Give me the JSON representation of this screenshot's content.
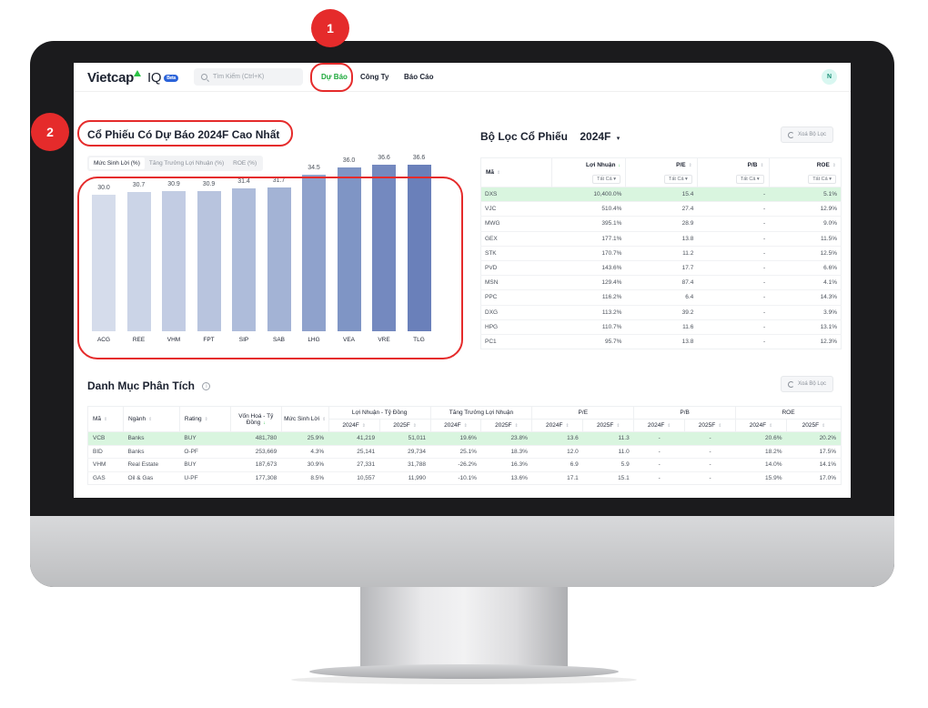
{
  "nav": {
    "logo": "Vietcap",
    "logo_suffix": "IQ",
    "logo_badge": "Beta",
    "search_placeholder": "Tìm Kiếm (Ctrl+K)",
    "menu": [
      "Dự Báo",
      "Công Ty",
      "Báo Cáo"
    ],
    "active_menu": "Dự Báo",
    "avatar": "N"
  },
  "callouts": [
    "1",
    "2"
  ],
  "forecast": {
    "title": "Cổ Phiếu Có Dự Báo 2024F Cao Nhất",
    "tabs": [
      "Mức Sinh Lời (%)",
      "Tăng Trưởng Lợi Nhuận (%)",
      "ROE (%)"
    ],
    "active_tab": "Mức Sinh Lời (%)"
  },
  "chart_data": {
    "type": "bar",
    "categories": [
      "ACG",
      "REE",
      "VHM",
      "FPT",
      "SIP",
      "SAB",
      "LHG",
      "VEA",
      "VRE",
      "TLG"
    ],
    "values": [
      30.0,
      30.7,
      30.9,
      30.9,
      31.4,
      31.7,
      34.5,
      36.0,
      36.6,
      36.6
    ],
    "value_labels": [
      "30.0",
      "30.7",
      "30.9",
      "30.9",
      "31.4",
      "31.7",
      "34.5",
      "36.0",
      "36.6",
      "36.6"
    ],
    "colors": [
      "#d5dceb",
      "#cbd4e7",
      "#c2cce3",
      "#b8c4de",
      "#aebcda",
      "#a3b3d5",
      "#8fa2cc",
      "#7f95c5",
      "#7489bf",
      "#6a80ba"
    ],
    "ylim": [
      0,
      40
    ],
    "grid": false
  },
  "filter": {
    "title": "Bộ Lọc Cổ Phiếu",
    "year": "2024F",
    "clear_label": "Xoá Bộ Lọc",
    "headers": [
      "Mã",
      "Lợi Nhuận",
      "P/E",
      "P/B",
      "ROE"
    ],
    "filter_label": "Tất Cả",
    "rows": [
      [
        "DXS",
        "10,400.0%",
        "15.4",
        "-",
        "5.1%"
      ],
      [
        "VJC",
        "510.4%",
        "27.4",
        "-",
        "12.9%"
      ],
      [
        "MWG",
        "395.1%",
        "28.9",
        "-",
        "9.0%"
      ],
      [
        "GEX",
        "177.1%",
        "13.8",
        "-",
        "11.5%"
      ],
      [
        "STK",
        "170.7%",
        "11.2",
        "-",
        "12.5%"
      ],
      [
        "PVD",
        "143.6%",
        "17.7",
        "-",
        "6.6%"
      ],
      [
        "MSN",
        "129.4%",
        "87.4",
        "-",
        "4.1%"
      ],
      [
        "PPC",
        "116.2%",
        "6.4",
        "-",
        "14.3%"
      ],
      [
        "DXG",
        "113.2%",
        "39.2",
        "-",
        "3.9%"
      ],
      [
        "HPG",
        "110.7%",
        "11.6",
        "-",
        "13.1%"
      ],
      [
        "PC1",
        "95.7%",
        "13.8",
        "-",
        "12.3%"
      ]
    ]
  },
  "portfolio": {
    "title": "Danh Mục Phân Tích",
    "clear_label": "Xoá Bộ Lọc",
    "headers": [
      "Mã",
      "Ngành",
      "Rating",
      "Vốn Hoá - Tỷ Đồng",
      "Mức Sinh Lời",
      "Lợi Nhuận - Tỷ Đồng",
      "Tăng Trưởng Lợi Nhuận",
      "P/E",
      "P/B",
      "ROE"
    ],
    "years": [
      "2024F",
      "2025F"
    ],
    "rows": [
      [
        "VCB",
        "Banks",
        "BUY",
        "481,780",
        "25.9%",
        "41,219",
        "51,011",
        "19.6%",
        "23.8%",
        "13.6",
        "11.3",
        "-",
        "-",
        "20.6%",
        "20.2%"
      ],
      [
        "BID",
        "Banks",
        "O-PF",
        "253,669",
        "4.3%",
        "25,141",
        "29,734",
        "25.1%",
        "18.3%",
        "12.0",
        "11.0",
        "-",
        "-",
        "18.2%",
        "17.5%"
      ],
      [
        "VHM",
        "Real Estate",
        "BUY",
        "187,673",
        "30.9%",
        "27,331",
        "31,788",
        "-26.2%",
        "16.3%",
        "6.9",
        "5.9",
        "-",
        "-",
        "14.0%",
        "14.1%"
      ],
      [
        "GAS",
        "Oil & Gas",
        "U-PF",
        "177,308",
        "8.5%",
        "10,557",
        "11,990",
        "-10.1%",
        "13.6%",
        "17.1",
        "15.1",
        "-",
        "-",
        "15.9%",
        "17.0%"
      ]
    ]
  }
}
